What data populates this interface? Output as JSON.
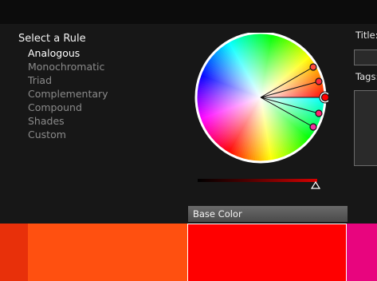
{
  "rules": {
    "title": "Select a Rule",
    "items": [
      "Analogous",
      "Monochromatic",
      "Triad",
      "Complementary",
      "Compound",
      "Shades",
      "Custom"
    ],
    "selected": "Analogous"
  },
  "fields": {
    "title_label": "Title:",
    "tags_label": "Tags:"
  },
  "swatches": {
    "base_label": "Base Color",
    "colors": [
      "#e8300a",
      "#ff5010",
      "#ff0000",
      "#e8057e"
    ]
  },
  "wheel": {
    "marker_colors": [
      "#ff4a3a",
      "#ff2c3c",
      "#ff0000",
      "#ff2070",
      "#f030a0"
    ],
    "base_marker_index": 2
  },
  "brightness": {
    "value": 0.95
  }
}
